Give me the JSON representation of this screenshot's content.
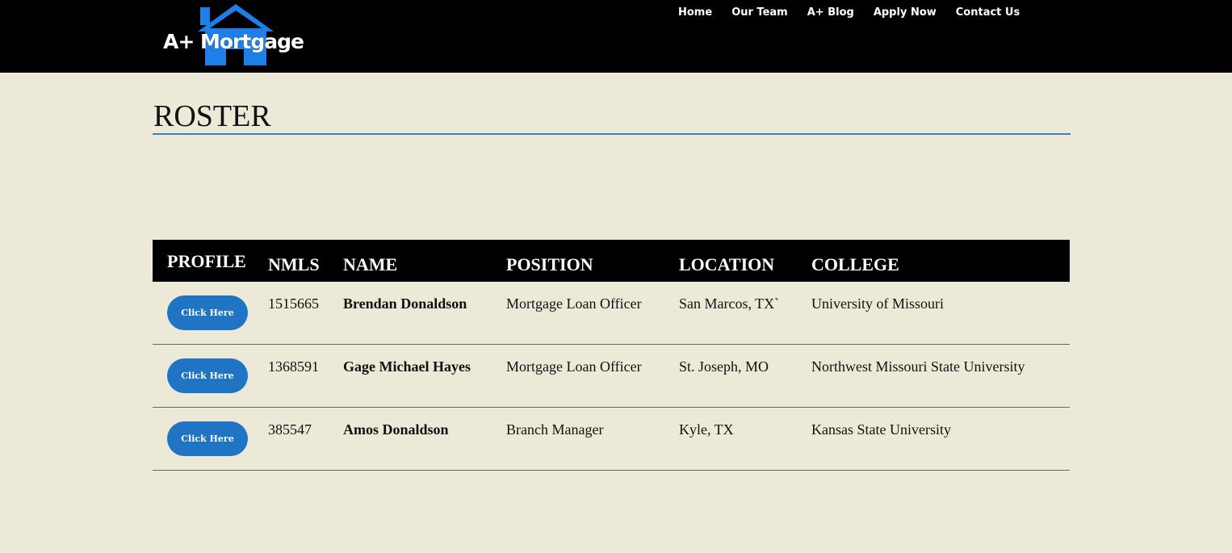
{
  "brand": {
    "logo_text": "A+ Mortgage",
    "accent": "#1f7fe8"
  },
  "nav": [
    "Home",
    "Our Team",
    "A+ Blog",
    "Apply Now",
    "Contact Us"
  ],
  "page": {
    "title": "ROSTER"
  },
  "table": {
    "headers": {
      "profile": "PROFILE",
      "nmls": "NMLS",
      "name": "NAME",
      "position": "POSITION",
      "location": "LOCATION",
      "college": "COLLEGE"
    },
    "rows": [
      {
        "button": "Click Here",
        "nmls": "1515665",
        "name": "Brendan Donaldson",
        "position": "Mortgage Loan Officer",
        "location": "San Marcos, TX`",
        "college": "University of Missouri"
      },
      {
        "button": "Click Here",
        "nmls": "1368591",
        "name": "Gage Michael Hayes",
        "position": "Mortgage Loan Officer",
        "location": "St. Joseph, MO",
        "college": "Northwest Missouri State University"
      },
      {
        "button": "Click Here",
        "nmls": "385547",
        "name": "Amos Donaldson",
        "position": "Branch Manager",
        "location": "Kyle, TX",
        "college": "Kansas State University"
      }
    ]
  }
}
